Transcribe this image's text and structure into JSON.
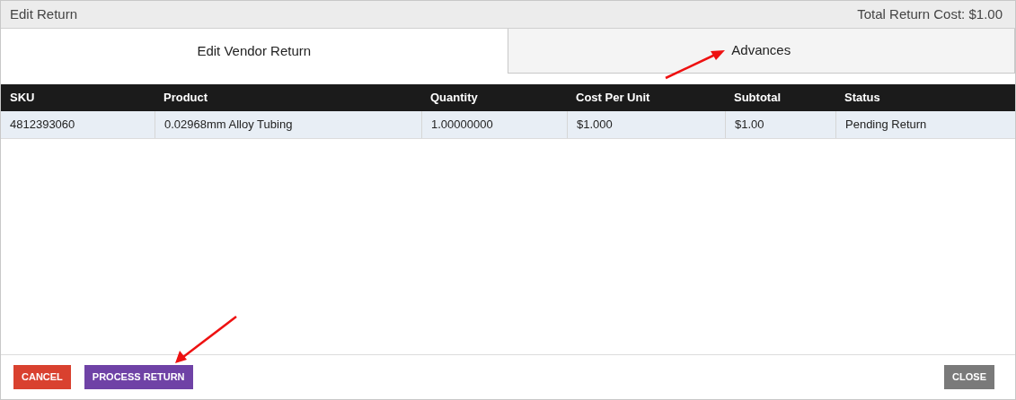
{
  "window": {
    "title": "Edit Return",
    "total": "Total Return Cost: $1.00"
  },
  "tabs": [
    {
      "label": "Edit Vendor Return",
      "selected": true
    },
    {
      "label": "Advances",
      "selected": false
    }
  ],
  "table": {
    "columns": [
      "SKU",
      "Product",
      "Quantity",
      "Cost Per Unit",
      "Subtotal",
      "Status"
    ],
    "rows": [
      [
        "4812393060",
        "0.02968mm Alloy Tubing",
        "1.00000000",
        "$1.000",
        "$1.00",
        "Pending Return"
      ]
    ]
  },
  "buttons": [
    {
      "label": "CANCEL",
      "kind": "danger"
    },
    {
      "label": "PROCESS RETURN",
      "kind": "primary"
    },
    {
      "label": "CLOSE",
      "kind": "neutral"
    }
  ]
}
